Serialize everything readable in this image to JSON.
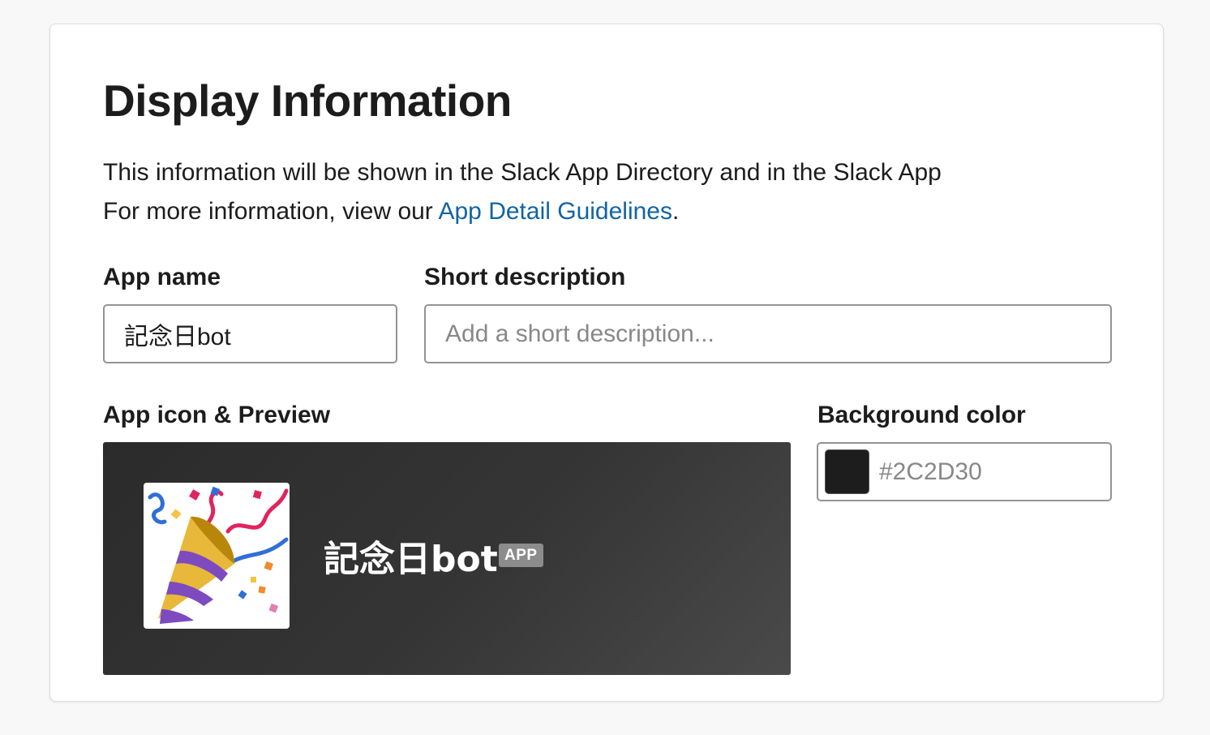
{
  "section": {
    "title": "Display Information",
    "description_line1": "This information will be shown in the Slack App Directory and in the Slack App",
    "description_line2_prefix": "For more information, view our ",
    "description_link": "App Detail Guidelines",
    "description_line2_suffix": "."
  },
  "fields": {
    "app_name": {
      "label": "App name",
      "value": "記念日bot"
    },
    "short_description": {
      "label": "Short description",
      "placeholder": "Add a short description..."
    },
    "app_icon": {
      "label": "App icon & Preview",
      "icon": "party-popper-icon"
    },
    "background_color": {
      "label": "Background color",
      "placeholder": "#2C2D30",
      "swatch_color": "#1d1d1d"
    }
  },
  "preview": {
    "app_name": "記念日bot",
    "badge": "APP"
  },
  "colors": {
    "link": "#1264a3",
    "preview_bg": "#2c2d30"
  }
}
